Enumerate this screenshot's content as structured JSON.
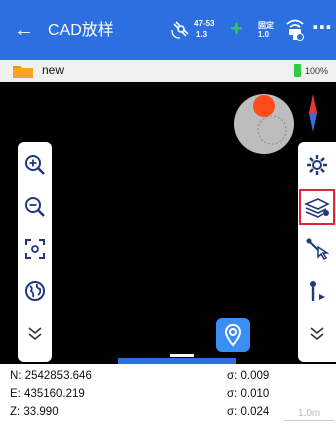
{
  "header": {
    "back_icon": "arrow-left-icon",
    "title": "CAD放样",
    "satellites": {
      "line1": "47-53",
      "line2": "1.3"
    },
    "fix": {
      "line1": "固定",
      "line2": "1.0"
    },
    "more_icon": "more-icon",
    "color": "#2b6fe0"
  },
  "project": {
    "name": "new",
    "battery": "100%",
    "battery_level": 1.0
  },
  "map": {
    "left_tools": [
      {
        "icon": "zoom-in-icon"
      },
      {
        "icon": "zoom-out-icon"
      },
      {
        "icon": "fit-extent-icon"
      },
      {
        "icon": "globe-icon"
      },
      {
        "icon": "chevron-down-icon"
      }
    ],
    "right_tools": [
      {
        "icon": "gear-icon"
      },
      {
        "icon": "layers-icon",
        "selected": true
      },
      {
        "icon": "select-line-icon"
      },
      {
        "icon": "stake-point-icon"
      },
      {
        "icon": "chevron-down-icon"
      }
    ],
    "locate_icon": "location-pin-icon"
  },
  "coords": {
    "n": "N:  2542853.646",
    "e": "E:  435160.219",
    "z": "Z:  33.990",
    "sigma_n": "σ:  0.009",
    "sigma_e": "σ:  0.010",
    "sigma_z": "σ:  0.024",
    "scale": "1.0m"
  }
}
